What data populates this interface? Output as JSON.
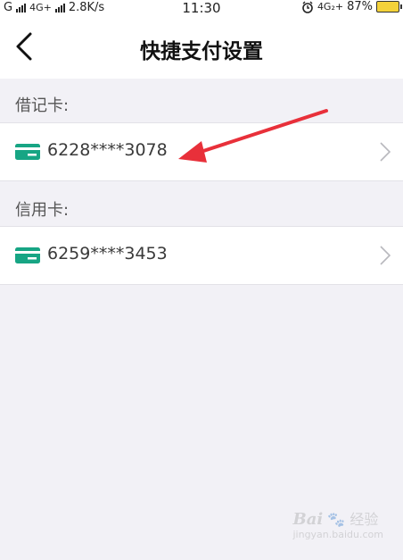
{
  "status_bar": {
    "left_text": "G",
    "network2": "4G+",
    "speed": "2.8K/s",
    "time": "11:30",
    "right_network": "4G₂+",
    "battery": "87%"
  },
  "nav": {
    "title": "快捷支付设置"
  },
  "debit": {
    "label": "借记卡:",
    "card_number": "6228****3078"
  },
  "credit": {
    "label": "信用卡:",
    "card_number": "6259****3453"
  },
  "watermark": {
    "logo": "Bai",
    "logo2": "经验",
    "url": "jingyan.baidu.com"
  },
  "colors": {
    "card_icon": "#17a584",
    "annotation_arrow": "#e8303a",
    "battery": "#f4d23a"
  }
}
